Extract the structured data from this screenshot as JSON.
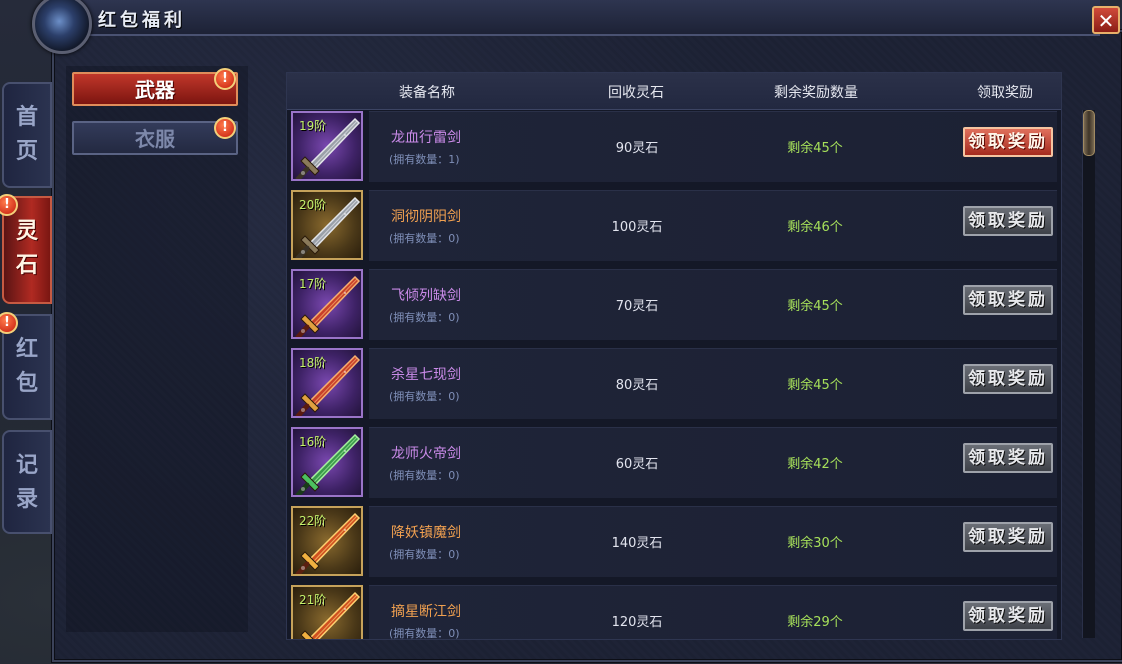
{
  "window": {
    "title": "红包福利",
    "close_label": "✕"
  },
  "tabs": [
    {
      "label": "首页",
      "active": false,
      "alert": false
    },
    {
      "label": "灵石",
      "active": true,
      "alert": true
    },
    {
      "label": "红包",
      "active": false,
      "alert": true
    },
    {
      "label": "记录",
      "active": false,
      "alert": false
    }
  ],
  "categories": [
    {
      "label": "武器",
      "active": true,
      "alert": true
    },
    {
      "label": "衣服",
      "active": false,
      "alert": true
    }
  ],
  "alert_mark": "!",
  "table": {
    "headers": {
      "name": "装备名称",
      "price": "回收灵石",
      "remain": "剩余奖励数量",
      "action": "领取奖励"
    },
    "rows": [
      {
        "tier": "19阶",
        "name": "龙血行雷剑",
        "name_color": "purple",
        "frame": "purple",
        "count": "(拥有数量：1)",
        "price": "90灵石",
        "remain": "剩余45个",
        "button": "领取奖励",
        "enabled": true,
        "blade": "gray"
      },
      {
        "tier": "20阶",
        "name": "洞彻阴阳剑",
        "name_color": "orange",
        "frame": "gold",
        "count": "(拥有数量：0)",
        "price": "100灵石",
        "remain": "剩余46个",
        "button": "领取奖励",
        "enabled": false,
        "blade": "gray"
      },
      {
        "tier": "17阶",
        "name": "飞倾列缺剑",
        "name_color": "purple",
        "frame": "purple",
        "count": "(拥有数量：0)",
        "price": "70灵石",
        "remain": "剩余45个",
        "button": "领取奖励",
        "enabled": false,
        "blade": "red"
      },
      {
        "tier": "18阶",
        "name": "杀星七现剑",
        "name_color": "purple",
        "frame": "purple",
        "count": "(拥有数量：0)",
        "price": "80灵石",
        "remain": "剩余45个",
        "button": "领取奖励",
        "enabled": false,
        "blade": "red"
      },
      {
        "tier": "16阶",
        "name": "龙师火帝剑",
        "name_color": "purple",
        "frame": "purple",
        "count": "(拥有数量：0)",
        "price": "60灵石",
        "remain": "剩余42个",
        "button": "领取奖励",
        "enabled": false,
        "blade": "green"
      },
      {
        "tier": "22阶",
        "name": "降妖镇魔剑",
        "name_color": "orange",
        "frame": "gold",
        "count": "(拥有数量：0)",
        "price": "140灵石",
        "remain": "剩余30个",
        "button": "领取奖励",
        "enabled": false,
        "blade": "fire"
      },
      {
        "tier": "21阶",
        "name": "摘星断江剑",
        "name_color": "orange",
        "frame": "gold",
        "count": "(拥有数量：0)",
        "price": "120灵石",
        "remain": "剩余29个",
        "button": "领取奖励",
        "enabled": false,
        "blade": "fire"
      }
    ]
  },
  "colors": {
    "purple_name": "#c98ae8",
    "orange_name": "#f0a050",
    "remain_green": "#a6e05a",
    "tier_green": "#c4f06c",
    "active_red": "#b02a22"
  },
  "icons": {
    "close": "close-icon",
    "alert": "alert-icon",
    "item": "sword-icon",
    "orb": "orb-emblem-icon"
  }
}
